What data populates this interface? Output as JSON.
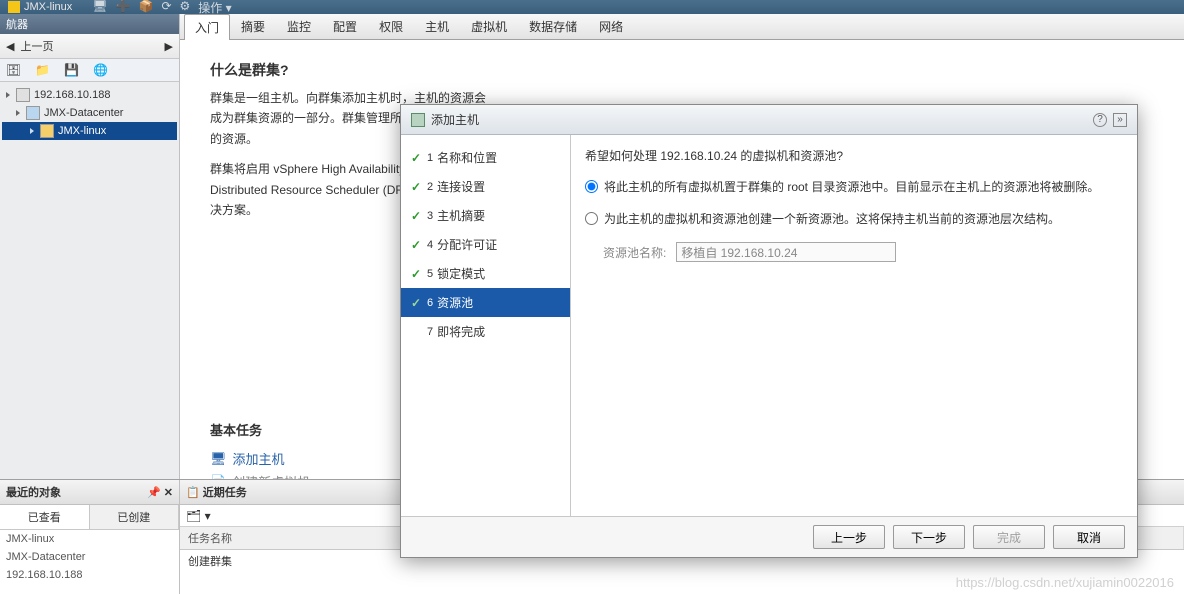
{
  "topbar": {
    "cluster_name": "JMX-linux",
    "actions_label": "操作"
  },
  "sidebar": {
    "nav_title": "航器",
    "back_label": "上一页",
    "tree": {
      "root_ip": "192.168.10.188",
      "datacenter": "JMX-Datacenter",
      "cluster": "JMX-linux"
    }
  },
  "tabs": [
    "入门",
    "摘要",
    "监控",
    "配置",
    "权限",
    "主机",
    "虚拟机",
    "数据存储",
    "网络"
  ],
  "intro": {
    "title": "什么是群集?",
    "p1": "群集是一组主机。向群集添加主机时，主机的资源会成为群集资源的一部分。群集管理所包含的所有主机的资源。",
    "p2": "群集将启用 vSphere High Availability (HA)、vSphere Distributed Resource Scheduler (DRS) 和 vSAN 解决方案。"
  },
  "basic_tasks": {
    "header": "基本任务",
    "add_host": "添加主机",
    "create_vm": "创建新虚拟机"
  },
  "recent": {
    "left_header": "最近的对象",
    "tab_viewed": "已查看",
    "tab_created": "已创建",
    "items": [
      "JMX-linux",
      "JMX-Datacenter",
      "192.168.10.188"
    ],
    "right_header": "近期任务",
    "col_taskname": "任务名称",
    "row_task": "创建群集"
  },
  "dialog": {
    "title": "添加主机",
    "steps": [
      "名称和位置",
      "连接设置",
      "主机摘要",
      "分配许可证",
      "锁定模式",
      "资源池",
      "即将完成"
    ],
    "active_step_index": 5,
    "question": "希望如何处理 192.168.10.24 的虚拟机和资源池?",
    "opt1": "将此主机的所有虚拟机置于群集的 root 目录资源池中。目前显示在主机上的资源池将被删除。",
    "opt2": "为此主机的虚拟机和资源池创建一个新资源池。这将保持主机当前的资源池层次结构。",
    "pool_label": "资源池名称:",
    "pool_value": "移植自 192.168.10.24",
    "btn_back": "上一步",
    "btn_next": "下一步",
    "btn_finish": "完成",
    "btn_cancel": "取消"
  },
  "watermark": "https://blog.csdn.net/xujiamin0022016"
}
